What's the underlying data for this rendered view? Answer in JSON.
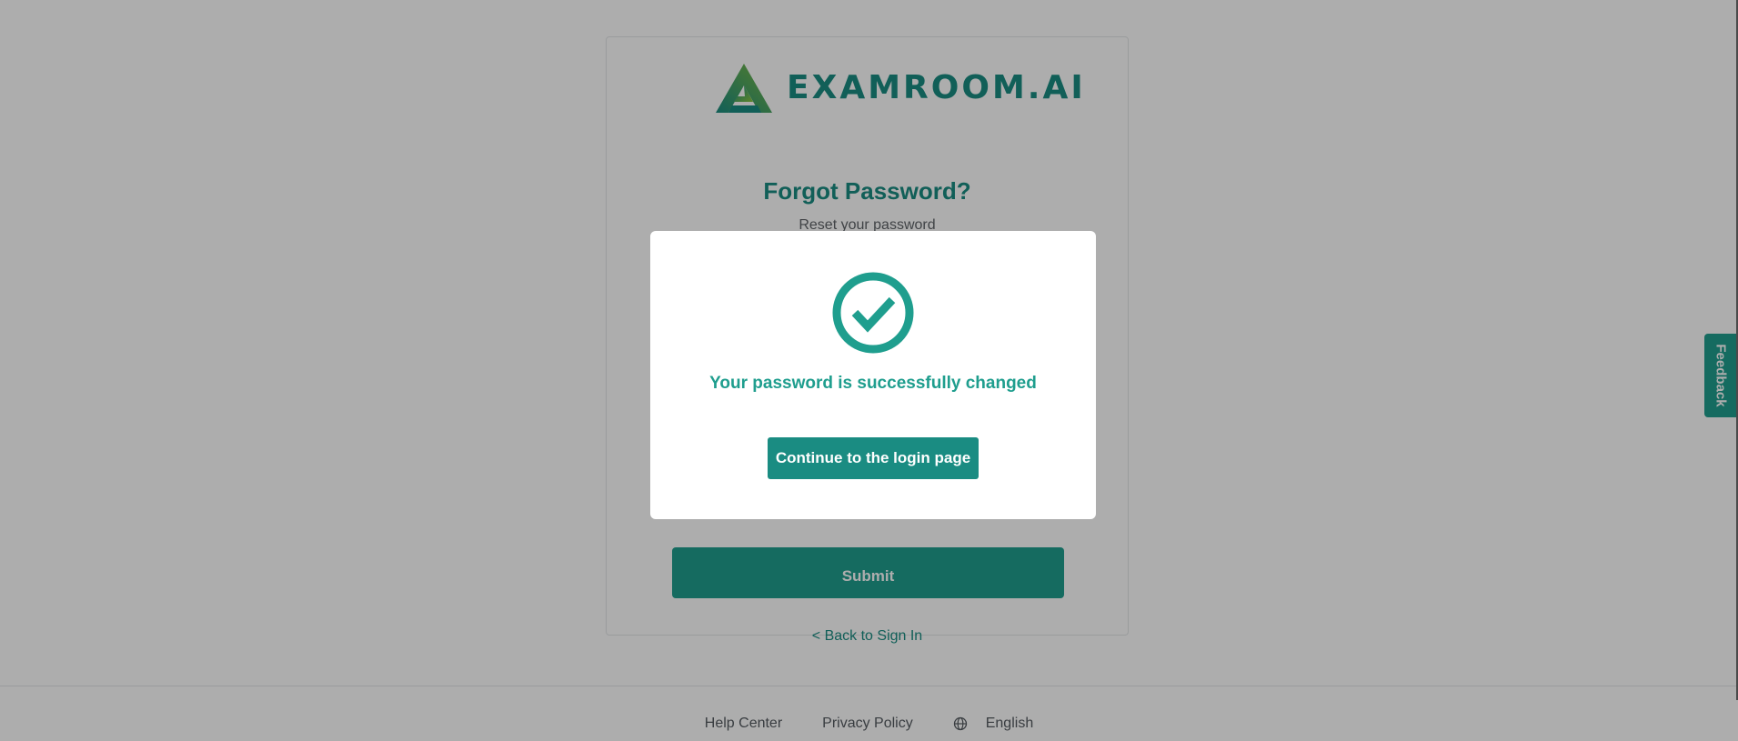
{
  "brand": {
    "name": "EXAMROOM.AI",
    "primary_color": "#1a8c82",
    "logo_gradient": [
      "#1a8c82",
      "#7dbb42"
    ]
  },
  "card": {
    "title": "Forgot Password?",
    "subtitle": "Reset your password",
    "submit_label": "Submit",
    "back_link": "< Back to Sign In"
  },
  "footer": {
    "help_center": "Help Center",
    "privacy_policy": "Privacy Policy",
    "language": "English",
    "language_icon": "globe-icon"
  },
  "feedback_tab": {
    "label": "Feedback"
  },
  "modal": {
    "icon": "check-circle-icon",
    "message": "Your password is successfully changed",
    "button_label": "Continue to the login page"
  }
}
